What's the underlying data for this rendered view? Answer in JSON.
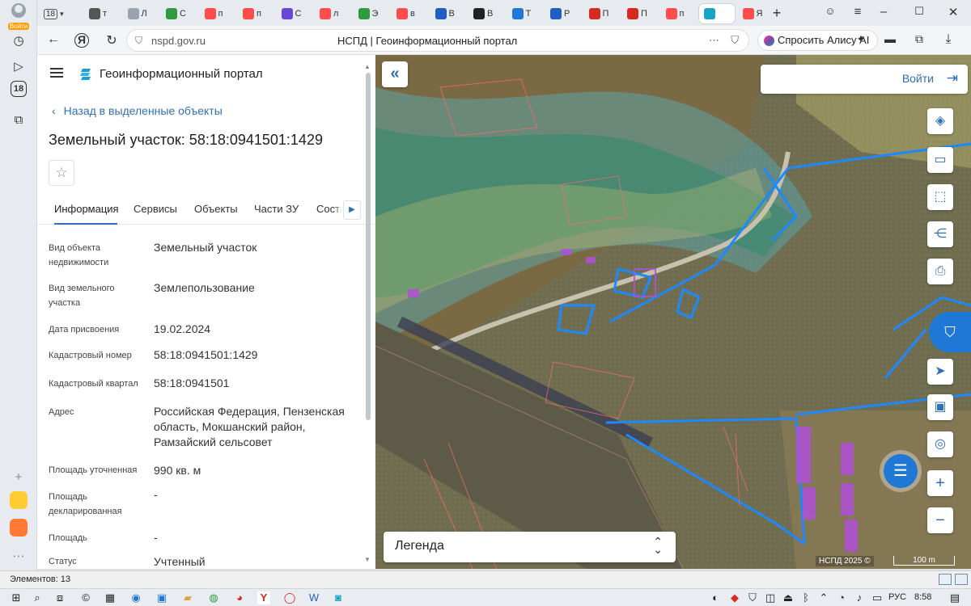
{
  "browser": {
    "account_label": "Войти",
    "side_badge": "18",
    "tab_count": "18",
    "tabs": [
      {
        "label": "т",
        "color": "#555555"
      },
      {
        "label": "Л",
        "color": "#9aa3ad"
      },
      {
        "label": "С",
        "color": "#2e9b3e"
      },
      {
        "label": "п",
        "color": "#ff4d4d"
      },
      {
        "label": "п",
        "color": "#ff4d4d"
      },
      {
        "label": "С",
        "color": "#6a46d8"
      },
      {
        "label": "л",
        "color": "#ff4d4d"
      },
      {
        "label": "Э",
        "color": "#2e9b3e"
      },
      {
        "label": "в",
        "color": "#ff4d4d"
      },
      {
        "label": "В",
        "color": "#1f5fbf"
      },
      {
        "label": "В",
        "color": "#222222"
      },
      {
        "label": "Т",
        "color": "#1f78d6"
      },
      {
        "label": "Р",
        "color": "#1f5fbf"
      },
      {
        "label": "П",
        "color": "#d52b1e"
      },
      {
        "label": "П",
        "color": "#d52b1e"
      },
      {
        "label": "п",
        "color": "#ff4d4d"
      },
      {
        "label": "",
        "color": "#1aa3c4"
      },
      {
        "label": "Я",
        "color": "#ff4d4d"
      }
    ],
    "new_tab": "+",
    "url": "nspd.gov.ru",
    "page_title": "НСПД | Геоинформационный портал",
    "alice_label": "Спросить Алису AI"
  },
  "panel": {
    "portal_title": "Геоинформационный портал",
    "back_link": "Назад в выделенные объекты",
    "object_title": "Земельный участок: 58:18:0941501:1429",
    "tabs": [
      "Информация",
      "Сервисы",
      "Объекты",
      "Части ЗУ",
      "Соста"
    ],
    "rows": [
      {
        "label": "Вид объекта недвижимости",
        "value": "Земельный участок"
      },
      {
        "label": "Вид земельного участка",
        "value": "Землепользование"
      },
      {
        "label": "Дата присвоения",
        "value": "19.02.2024"
      },
      {
        "label": "Кадастровый номер",
        "value": "58:18:0941501:1429"
      },
      {
        "label": "Кадастровый квартал",
        "value": "58:18:0941501"
      },
      {
        "label": "Адрес",
        "value": "Российская Федерация, Пензенская область, Мокшанский район, Рамзайский сельсовет"
      },
      {
        "label": "Площадь уточненная",
        "value": "990 кв. м"
      },
      {
        "label": "Площадь декларированная",
        "value": "-"
      },
      {
        "label": "Площадь",
        "value": "-"
      },
      {
        "label": "Статус",
        "value": "Учтенный"
      }
    ]
  },
  "map": {
    "login_label": "Войти",
    "legend_label": "Легенда",
    "copyright": "НСПД 2025 ©",
    "scale_label": "100 m"
  },
  "statusbar": {
    "elements_text": "Элементов: 13"
  },
  "taskbar": {
    "lang": "РУС",
    "time": "8:58"
  }
}
